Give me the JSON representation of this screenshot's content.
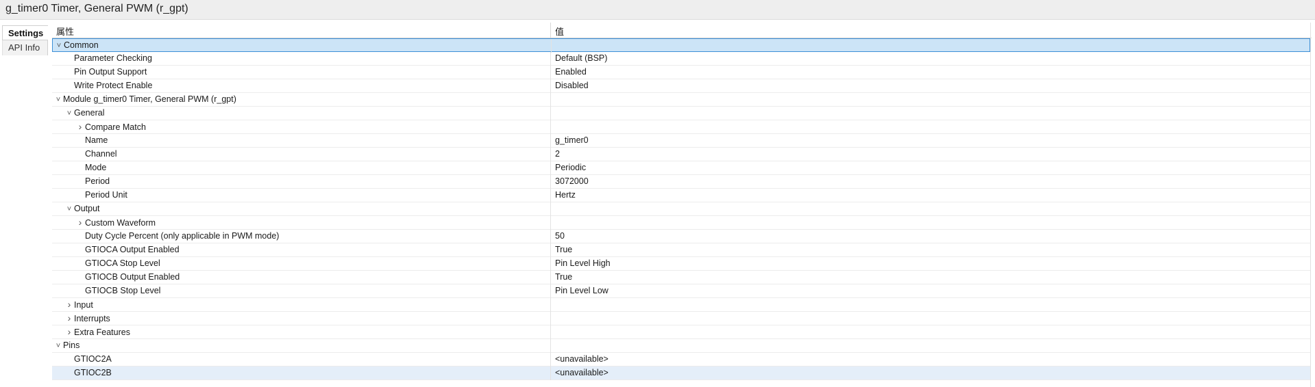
{
  "window": {
    "title": "g_timer0 Timer, General PWM (r_gpt)"
  },
  "tabs": [
    {
      "label": "Settings",
      "active": true
    },
    {
      "label": "API Info",
      "active": false
    }
  ],
  "table": {
    "col_property": "属性",
    "col_value": "值"
  },
  "icons": {
    "expanded": "chevron-down-icon",
    "collapsed": "chevron-right-icon"
  },
  "colors": {
    "selection": "#cce4f7",
    "selection_border": "#3c8fd6",
    "hover": "#e4eef9"
  },
  "rows": [
    {
      "level": 0,
      "toggle": "expanded",
      "label": "Common",
      "value": "",
      "state": "selected"
    },
    {
      "level": 1,
      "toggle": "none",
      "label": "Parameter Checking",
      "value": "Default (BSP)"
    },
    {
      "level": 1,
      "toggle": "none",
      "label": "Pin Output Support",
      "value": "Enabled"
    },
    {
      "level": 1,
      "toggle": "none",
      "label": "Write Protect Enable",
      "value": "Disabled"
    },
    {
      "level": 0,
      "toggle": "expanded",
      "label": "Module g_timer0 Timer, General PWM (r_gpt)",
      "value": ""
    },
    {
      "level": 1,
      "toggle": "expanded",
      "label": "General",
      "value": ""
    },
    {
      "level": 2,
      "toggle": "collapsed",
      "label": "Compare Match",
      "value": ""
    },
    {
      "level": 2,
      "toggle": "none",
      "label": "Name",
      "value": "g_timer0"
    },
    {
      "level": 2,
      "toggle": "none",
      "label": "Channel",
      "value": "2"
    },
    {
      "level": 2,
      "toggle": "none",
      "label": "Mode",
      "value": "Periodic"
    },
    {
      "level": 2,
      "toggle": "none",
      "label": "Period",
      "value": "3072000"
    },
    {
      "level": 2,
      "toggle": "none",
      "label": "Period Unit",
      "value": "Hertz"
    },
    {
      "level": 1,
      "toggle": "expanded",
      "label": "Output",
      "value": ""
    },
    {
      "level": 2,
      "toggle": "collapsed",
      "label": "Custom Waveform",
      "value": ""
    },
    {
      "level": 2,
      "toggle": "none",
      "label": "Duty Cycle Percent (only applicable in PWM mode)",
      "value": "50"
    },
    {
      "level": 2,
      "toggle": "none",
      "label": "GTIOCA Output Enabled",
      "value": "True"
    },
    {
      "level": 2,
      "toggle": "none",
      "label": "GTIOCA Stop Level",
      "value": "Pin Level High"
    },
    {
      "level": 2,
      "toggle": "none",
      "label": "GTIOCB Output Enabled",
      "value": "True"
    },
    {
      "level": 2,
      "toggle": "none",
      "label": "GTIOCB Stop Level",
      "value": "Pin Level Low"
    },
    {
      "level": 1,
      "toggle": "collapsed",
      "label": "Input",
      "value": ""
    },
    {
      "level": 1,
      "toggle": "collapsed",
      "label": "Interrupts",
      "value": ""
    },
    {
      "level": 1,
      "toggle": "collapsed",
      "label": "Extra Features",
      "value": ""
    },
    {
      "level": 0,
      "toggle": "expanded",
      "label": "Pins",
      "value": ""
    },
    {
      "level": 1,
      "toggle": "none",
      "label": "GTIOC2A",
      "value": "<unavailable>"
    },
    {
      "level": 1,
      "toggle": "none",
      "label": "GTIOC2B",
      "value": "<unavailable>",
      "state": "highlighted"
    }
  ]
}
